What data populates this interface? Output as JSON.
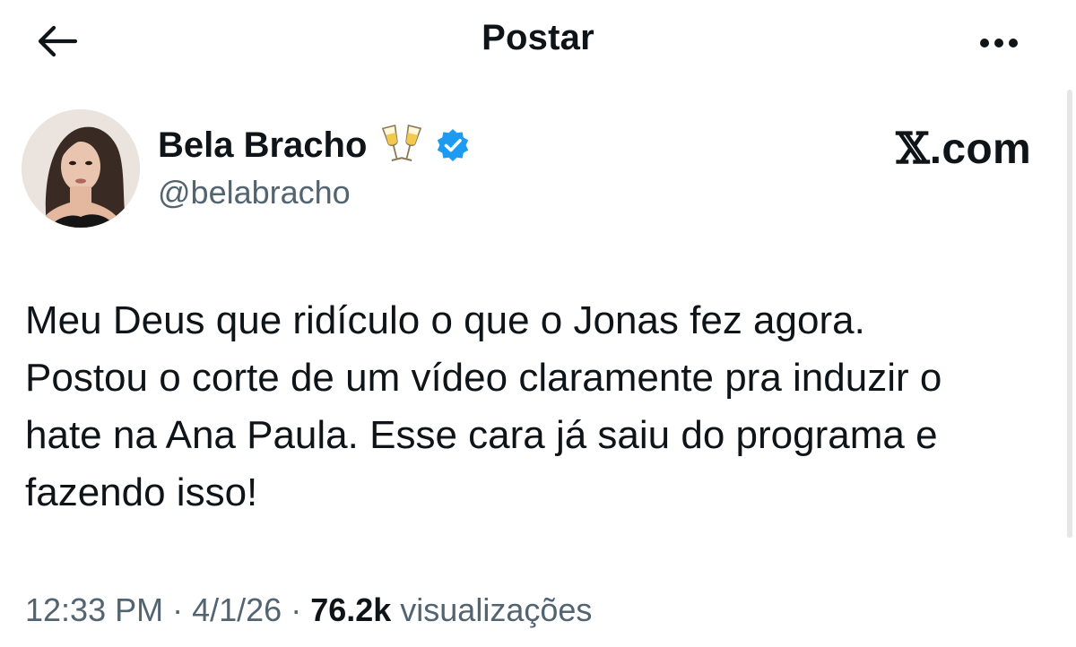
{
  "header": {
    "title": "Postar",
    "back_icon": "arrow-left-icon",
    "more_icon": "more-horizontal-icon"
  },
  "author": {
    "display_name": "Bela Bracho",
    "name_emoji": "🥂",
    "handle": "@belabracho",
    "verified": true,
    "verified_color": "#1d9bf0"
  },
  "brand": {
    "x_mark": "𝕏",
    "domain": ".com"
  },
  "post": {
    "lines": [
      "Meu Deus que ridículo o que o Jonas fez agora.",
      "Postou o corte de um vídeo claramente pra induzir o",
      "hate na Ana Paula. Esse cara já saiu do programa e",
      "fazendo isso!"
    ]
  },
  "meta": {
    "time": "12:33 PM",
    "separator": " · ",
    "date": "4/1/26",
    "views_count": "76.2k",
    "views_label": " visualizações"
  },
  "colors": {
    "text_primary": "#0f1419",
    "text_secondary": "#536471",
    "accent": "#1d9bf0",
    "background": "#ffffff"
  }
}
